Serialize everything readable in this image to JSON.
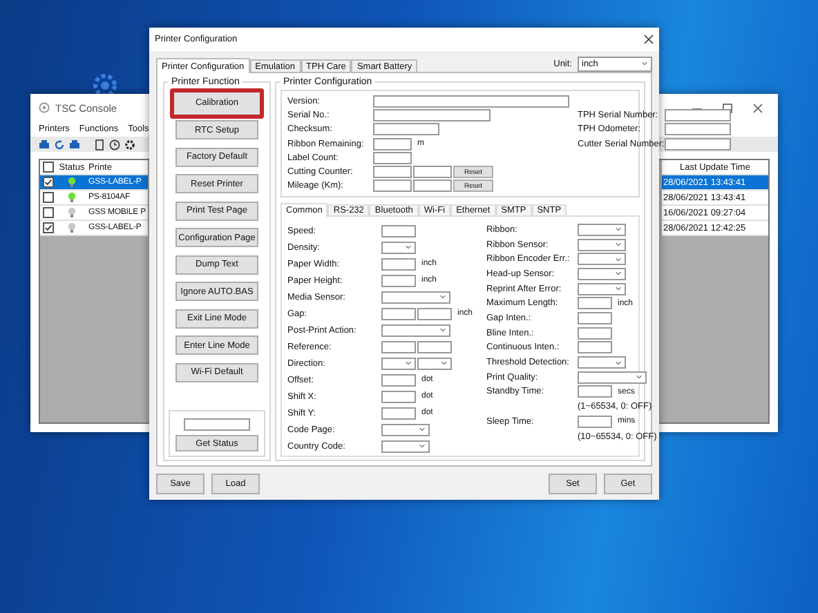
{
  "console_window": {
    "title": "TSC Console",
    "menu": [
      "Printers",
      "Functions",
      "Tools"
    ],
    "select_all_checked": false,
    "columns": [
      "Status",
      "Printe",
      "Last Update Time"
    ],
    "rows": [
      {
        "checked": true,
        "selected": true,
        "online": true,
        "printer": "GSS-LABEL-P",
        "time": "28/06/2021 13:43:41"
      },
      {
        "checked": false,
        "selected": false,
        "online": true,
        "printer": "PS-8104AF",
        "time": "28/06/2021 13:43:41"
      },
      {
        "checked": false,
        "selected": false,
        "online": false,
        "printer": "GSS MOBILE P",
        "time": "16/06/2021 09:27:04"
      },
      {
        "checked": true,
        "selected": false,
        "online": false,
        "printer": "GSS-LABEL-P",
        "time": "28/06/2021 12:42:25"
      }
    ]
  },
  "config_window": {
    "title": "Printer Configuration",
    "tabs": [
      {
        "label": "Printer Configuration",
        "selected": true
      },
      {
        "label": "Emulation",
        "selected": false
      },
      {
        "label": "TPH Care",
        "selected": false
      },
      {
        "label": "Smart Battery",
        "selected": false
      }
    ],
    "unit": {
      "label": "Unit:",
      "value": "inch"
    },
    "function_group": {
      "title": "Printer Function",
      "buttons": [
        {
          "label": "Calibration",
          "highlighted": true
        },
        {
          "label": "RTC Setup",
          "highlighted": false
        },
        {
          "label": "Factory Default",
          "highlighted": false
        },
        {
          "label": "Reset Printer",
          "highlighted": false
        },
        {
          "label": "Print Test Page",
          "highlighted": false
        },
        {
          "label": "Configuration Page",
          "highlighted": false
        },
        {
          "label": "Dump Text",
          "highlighted": false
        },
        {
          "label": "Ignore AUTO.BAS",
          "highlighted": false
        },
        {
          "label": "Exit Line Mode",
          "highlighted": false
        },
        {
          "label": "Enter Line Mode",
          "highlighted": false
        },
        {
          "label": "Wi-Fi Default",
          "highlighted": false
        }
      ],
      "status_button": "Get Status"
    },
    "config_group": {
      "title": "Printer Configuration",
      "info_rows": [
        {
          "label": "Version:",
          "kind": "long"
        },
        {
          "label": "Serial No.:",
          "kind": "medium",
          "right_label": "TPH Serial Number:"
        },
        {
          "label": "Checksum:",
          "kind": "short",
          "right_label": "TPH Odometer:"
        },
        {
          "label": "Ribbon Remaining:",
          "kind": "tiny",
          "unit": "m",
          "right_label": "Cutter Serial Number:"
        },
        {
          "label": "Label Count:",
          "kind": "tiny"
        },
        {
          "label": "Cutting Counter:",
          "kind": "counter",
          "button": "Reset"
        },
        {
          "label": "Mileage (Km):",
          "kind": "counter",
          "button": "Reset"
        }
      ],
      "tabs": [
        {
          "label": "Common",
          "selected": true
        },
        {
          "label": "RS-232",
          "selected": false
        },
        {
          "label": "Bluetooth",
          "selected": false
        },
        {
          "label": "Wi-Fi",
          "selected": false
        },
        {
          "label": "Ethernet",
          "selected": false
        },
        {
          "label": "SMTP",
          "selected": false
        },
        {
          "label": "SNTP",
          "selected": false
        }
      ],
      "left_fields": [
        {
          "label": "Speed:",
          "kind": "text"
        },
        {
          "label": "Density:",
          "kind": "select"
        },
        {
          "label": "Paper Width:",
          "kind": "text",
          "unit": "inch"
        },
        {
          "label": "Paper Height:",
          "kind": "text",
          "unit": "inch"
        },
        {
          "label": "Media Sensor:",
          "kind": "select-wide"
        },
        {
          "label": "Gap:",
          "kind": "text2",
          "unit": "inch"
        },
        {
          "label": "Post-Print Action:",
          "kind": "select-wide"
        },
        {
          "label": "Reference:",
          "kind": "text2"
        },
        {
          "label": "Direction:",
          "kind": "select2"
        },
        {
          "label": "Offset:",
          "kind": "text",
          "unit": "dot"
        },
        {
          "label": "Shift X:",
          "kind": "text",
          "unit": "dot"
        },
        {
          "label": "Shift Y:",
          "kind": "text",
          "unit": "dot"
        },
        {
          "label": "Code Page:",
          "kind": "select-mid"
        },
        {
          "label": "Country Code:",
          "kind": "select-mid"
        }
      ],
      "right_fields": [
        {
          "label": "Ribbon:",
          "kind": "select-mid"
        },
        {
          "label": "Ribbon Sensor:",
          "kind": "select-mid"
        },
        {
          "label": "Ribbon Encoder Err.:",
          "kind": "select-mid"
        },
        {
          "label": "Head-up Sensor:",
          "kind": "select-mid"
        },
        {
          "label": "Reprint After Error:",
          "kind": "select-mid"
        },
        {
          "label": "Maximum Length:",
          "kind": "text",
          "unit": "inch"
        },
        {
          "label": "Gap Inten.:",
          "kind": "text"
        },
        {
          "label": "Bline Inten.:",
          "kind": "text"
        },
        {
          "label": "Continuous Inten.:",
          "kind": "text"
        },
        {
          "label": "Threshold Detection:",
          "kind": "select-mid"
        },
        {
          "label": "Print Quality:",
          "kind": "select-wide"
        },
        {
          "label": "Standby Time:",
          "kind": "text",
          "unit": "secs",
          "note": "(1~65534, 0: OFF)"
        },
        {
          "label": "Sleep Time:",
          "kind": "text",
          "unit": "mins",
          "note": "(10~65534, 0: OFF)"
        }
      ]
    },
    "left_buttons": [
      "Save",
      "Load"
    ],
    "right_buttons": [
      "Set",
      "Get"
    ]
  }
}
